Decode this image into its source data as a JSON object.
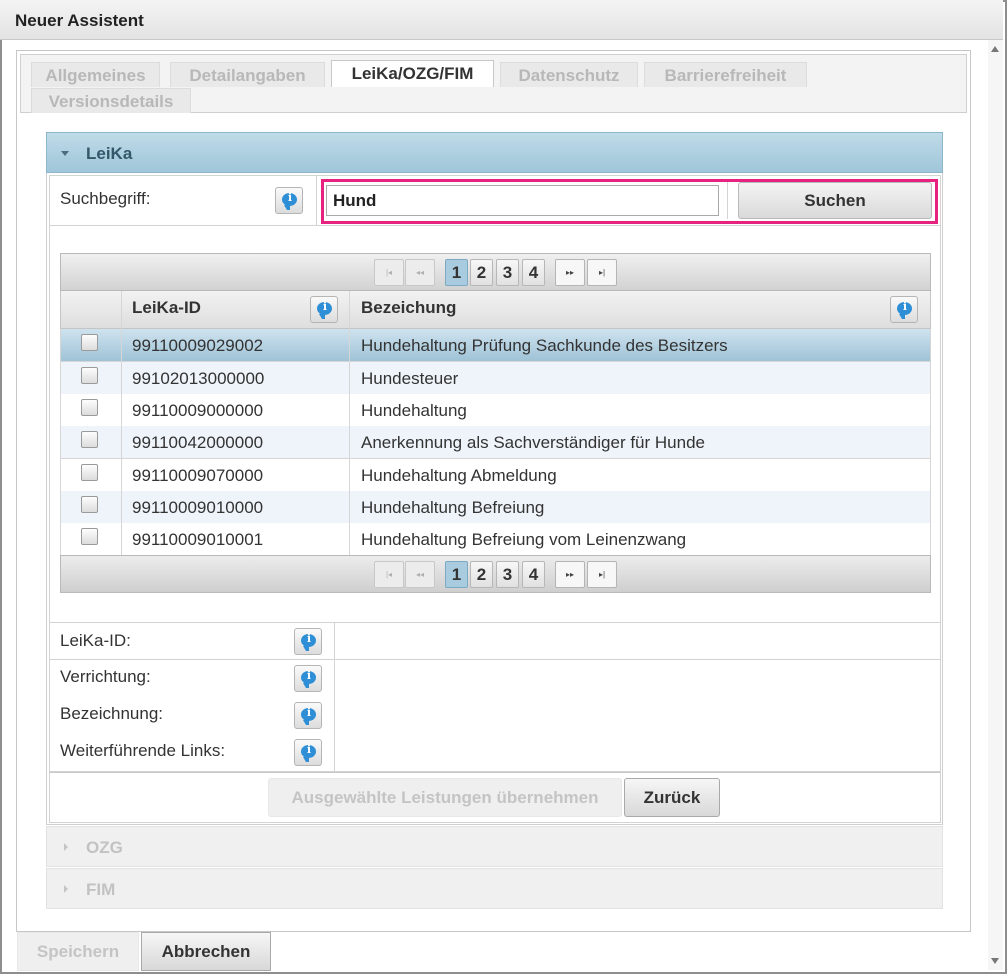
{
  "window": {
    "title": "Neuer Assistent"
  },
  "tabs": [
    {
      "label": "Allgemeines"
    },
    {
      "label": "Detailangaben"
    },
    {
      "label": "LeiKa/OZG/FIM"
    },
    {
      "label": "Datenschutz"
    },
    {
      "label": "Barrierefreiheit"
    },
    {
      "label": "Versionsdetails"
    }
  ],
  "active_tab": "LeiKa/OZG/FIM",
  "leika": {
    "header": "LeiKa",
    "search_label": "Suchbegriff:",
    "search_value": "Hund",
    "search_button": "Suchen",
    "pager": {
      "pages": [
        "1",
        "2",
        "3",
        "4"
      ],
      "current_page": "1"
    },
    "columns": {
      "id": "LeiKa-ID",
      "name": "Bezeichung"
    },
    "rows": [
      {
        "id": "99110009029002",
        "name": "Hundehaltung Prüfung Sachkunde des Besitzers",
        "selected": true
      },
      {
        "id": "99102013000000",
        "name": "Hundesteuer",
        "selected": false
      },
      {
        "id": "99110009000000",
        "name": "Hundehaltung",
        "selected": false
      },
      {
        "id": "99110042000000",
        "name": "Anerkennung als Sachverständiger für Hunde",
        "selected": false
      },
      {
        "id": "99110009070000",
        "name": "Hundehaltung Abmeldung",
        "selected": false
      },
      {
        "id": "99110009010000",
        "name": "Hundehaltung Befreiung",
        "selected": false
      },
      {
        "id": "99110009010001",
        "name": "Hundehaltung Befreiung vom Leinenzwang",
        "selected": false
      }
    ],
    "details": {
      "leika_id": "LeiKa-ID:",
      "verrichtung": "Verrichtung:",
      "bezeichnung": "Bezeichnung:",
      "links": "Weiterführende Links:"
    },
    "apply_button": "Ausgewählte Leistungen übernehmen",
    "back_button": "Zurück"
  },
  "collapsed_sections": {
    "ozg": "OZG",
    "fim": "FIM"
  },
  "footer": {
    "save_button": "Speichern",
    "cancel_button": "Abbrechen"
  },
  "colors": {
    "highlight": "#e6237e",
    "header_blue": "#9fc6d9",
    "selected_row": "#b5d4e5"
  }
}
